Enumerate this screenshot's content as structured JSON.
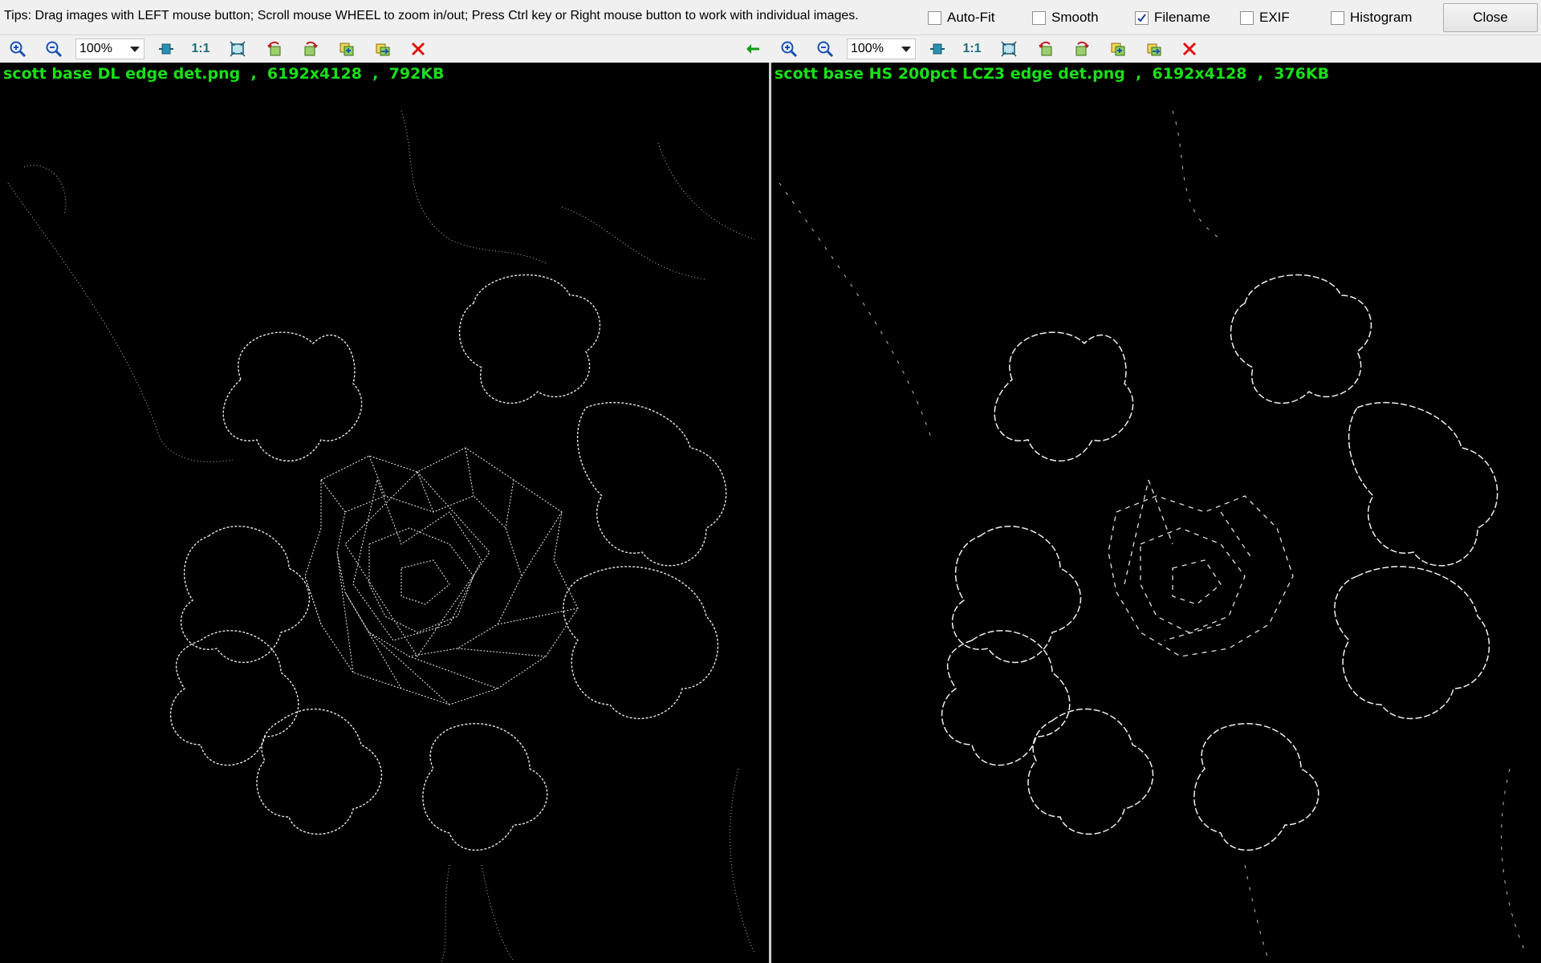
{
  "tips": "Tips: Drag images with LEFT mouse button; Scroll mouse WHEEL to zoom in/out; Press Ctrl key or Right mouse button to work with individual images.",
  "options": [
    {
      "label": "Auto-Fit",
      "checked": false
    },
    {
      "label": "Smooth",
      "checked": false
    },
    {
      "label": "Filename",
      "checked": true
    },
    {
      "label": "EXIF",
      "checked": false
    },
    {
      "label": "Histogram",
      "checked": false
    }
  ],
  "close_label": "Close",
  "left": {
    "zoom": "100%",
    "one_to_one": "1:1",
    "caption": "scott base DL edge det.png  ,  6192x4128  ,  792KB"
  },
  "right": {
    "zoom": "100%",
    "one_to_one": "1:1",
    "caption": "scott base HS 200pct LCZ3 edge det.png  ,  6192x4128  ,  376KB"
  },
  "icons": {
    "zoom_in": "zoom-in-icon",
    "zoom_out": "zoom-out-icon",
    "fit": "fit-icon",
    "fullscreen": "fullscreen-icon",
    "rotate_left": "rotate-left-icon",
    "rotate_right": "rotate-right-icon",
    "copy": "copy-icon",
    "save": "save-icon",
    "delete": "delete-icon",
    "sync_arrow": "sync-arrow-icon"
  },
  "colors": {
    "caption": "#18e018",
    "background": "#000000",
    "edges": "#e6e6e6",
    "delete": "#e01010",
    "arrow": "#10a010"
  }
}
